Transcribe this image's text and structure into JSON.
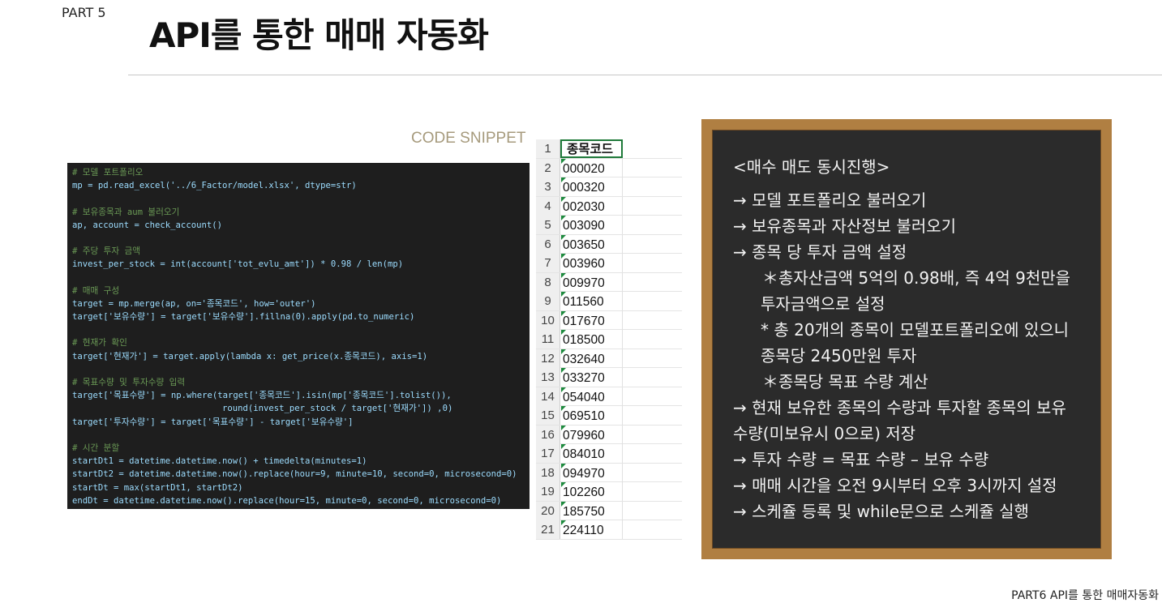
{
  "header": {
    "part_label": "PART 5",
    "title": "API를 통한 매매 자동화"
  },
  "snippet_label": "CODE SNIPPET",
  "code_lines": [
    {
      "text": "# 모델 포트폴리오",
      "kind": "comment"
    },
    {
      "text": "mp = pd.read_excel('../6_Factor/model.xlsx', dtype=str)",
      "kind": "code"
    },
    {
      "text": "",
      "kind": "code"
    },
    {
      "text": "# 보유종목과 aum 불러오기",
      "kind": "comment"
    },
    {
      "text": "ap, account = check_account()",
      "kind": "code"
    },
    {
      "text": "",
      "kind": "code"
    },
    {
      "text": "# 주당 투자 금액",
      "kind": "comment"
    },
    {
      "text": "invest_per_stock = int(account['tot_evlu_amt']) * 0.98 / len(mp)",
      "kind": "code"
    },
    {
      "text": "",
      "kind": "code"
    },
    {
      "text": "# 매매 구성",
      "kind": "comment"
    },
    {
      "text": "target = mp.merge(ap, on='종목코드', how='outer')",
      "kind": "code"
    },
    {
      "text": "target['보유수량'] = target['보유수량'].fillna(0).apply(pd.to_numeric)",
      "kind": "code"
    },
    {
      "text": "",
      "kind": "code"
    },
    {
      "text": "# 현재가 확인",
      "kind": "comment"
    },
    {
      "text": "target['현재가'] = target.apply(lambda x: get_price(x.종목코드), axis=1)",
      "kind": "code"
    },
    {
      "text": "",
      "kind": "code"
    },
    {
      "text": "# 목표수량 및 투자수량 입력",
      "kind": "comment"
    },
    {
      "text": "target['목표수량'] = np.where(target['종목코드'].isin(mp['종목코드'].tolist()),",
      "kind": "code"
    },
    {
      "text": "                             round(invest_per_stock / target['현재가']) ,0)",
      "kind": "code"
    },
    {
      "text": "target['투자수량'] = target['목표수량'] - target['보유수량']",
      "kind": "code"
    },
    {
      "text": "",
      "kind": "code"
    },
    {
      "text": "# 시간 분할",
      "kind": "comment"
    },
    {
      "text": "startDt1 = datetime.datetime.now() + timedelta(minutes=1)",
      "kind": "code"
    },
    {
      "text": "startDt2 = datetime.datetime.now().replace(hour=9, minute=10, second=0, microsecond=0)",
      "kind": "code"
    },
    {
      "text": "startDt = max(startDt1, startDt2)",
      "kind": "code"
    },
    {
      "text": "endDt = datetime.datetime.now().replace(hour=15, minute=0, second=0, microsecond=0)",
      "kind": "code"
    }
  ],
  "spreadsheet": {
    "header": "종목코드",
    "row_numbers": [
      "1",
      "2",
      "3",
      "4",
      "5",
      "6",
      "7",
      "8",
      "9",
      "10",
      "11",
      "12",
      "13",
      "14",
      "15",
      "16",
      "17",
      "18",
      "19",
      "20",
      "21"
    ],
    "codes": [
      "000020",
      "000320",
      "002030",
      "003090",
      "003650",
      "003960",
      "009970",
      "011560",
      "017670",
      "018500",
      "032640",
      "033270",
      "054040",
      "069510",
      "079960",
      "084010",
      "094970",
      "102260",
      "185750",
      "224110"
    ]
  },
  "blackboard": {
    "lines": [
      "<매수 매도 동시진행>",
      "→ 모델 포트폴리오 불러오기",
      "→ 보유종목과 자산정보 불러오기",
      "→ 종목 당 투자 금액 설정",
      "＊총자산금액 5억의 0.98배, 즉 4억 9천만을",
      "투자금액으로 설정",
      "* 총 20개의 종목이 모델포트폴리오에 있으니",
      "종목당 2450만원 투자",
      "＊종목당 목표 수량 계산",
      "→ 현재 보유한 종목의 수량과 투자할 종목의 보유",
      "수량(미보유시 0으로) 저장",
      "→ 투자 수량 = 목표 수량 – 보유 수량",
      "→ 매매 시간을 오전 9시부터 오후 3시까지 설정",
      "→ 스케쥴 등록 및 while문으로 스케쥴 실행"
    ]
  },
  "footer": "PART6 API를 통한 매매자동화"
}
